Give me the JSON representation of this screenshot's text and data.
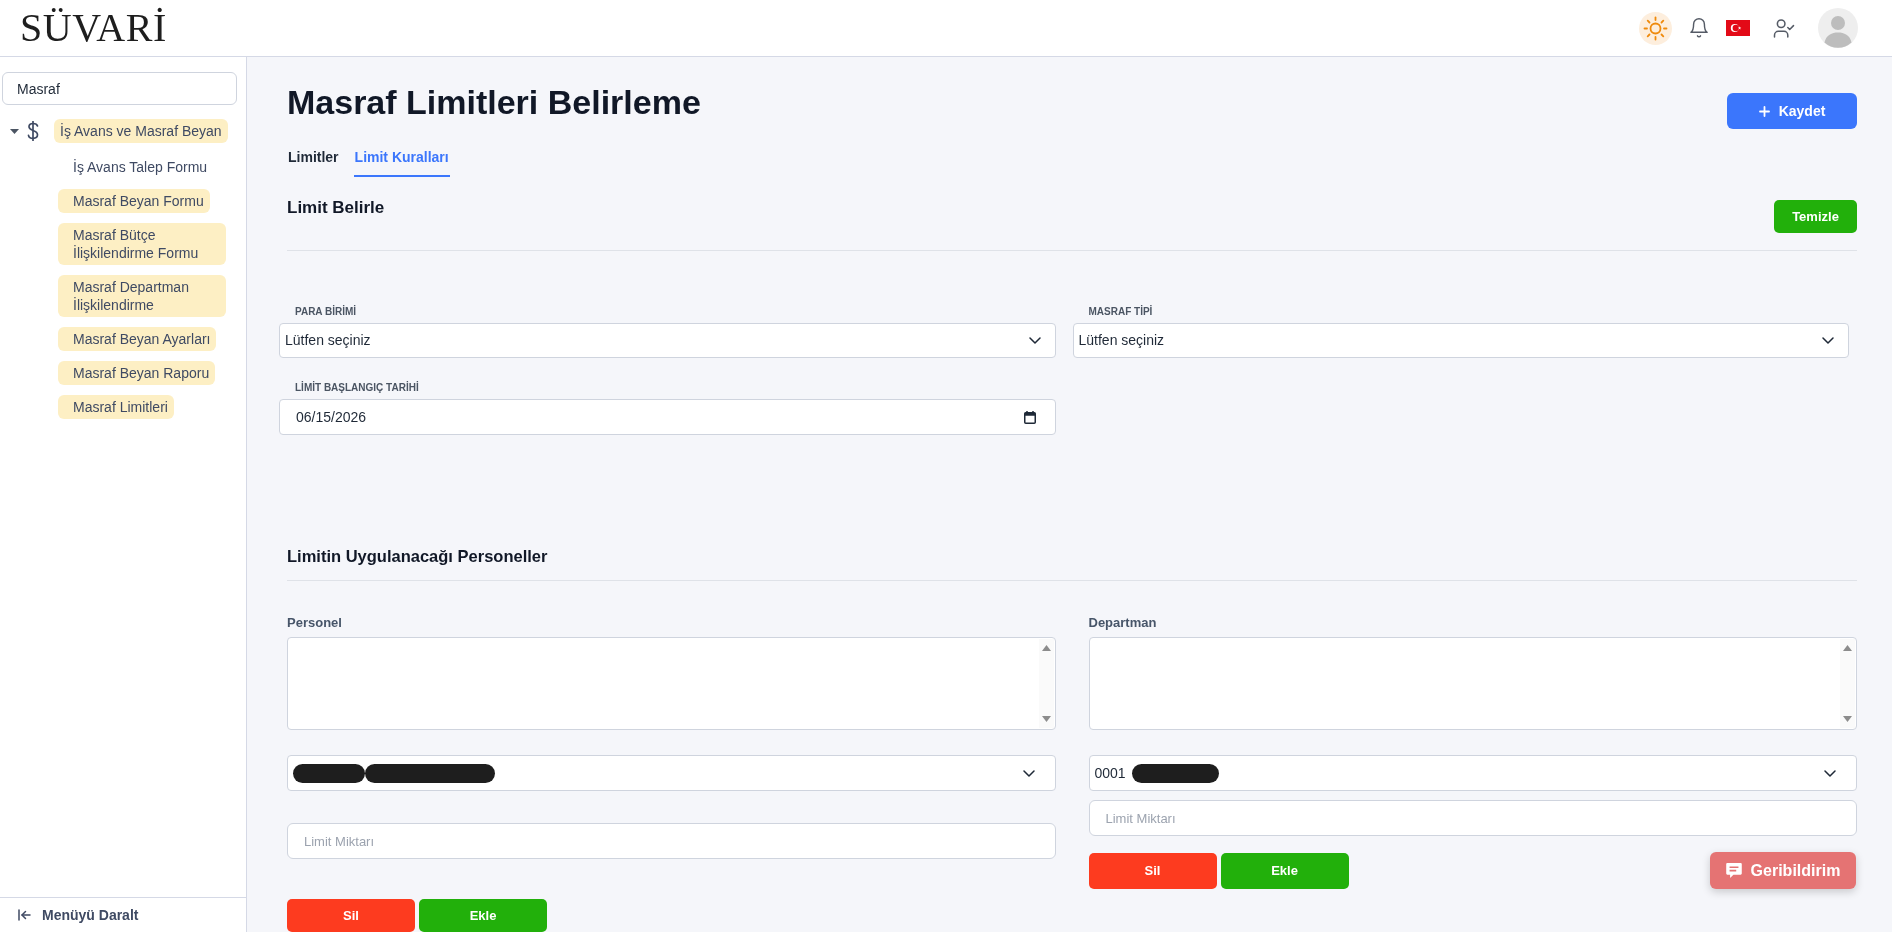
{
  "header": {
    "logo": "SÜVARİ"
  },
  "sidebar": {
    "search": {
      "value": "Masraf"
    },
    "tree": [
      {
        "label": "İş Avans ve Masraf Beyan",
        "expanded": true,
        "highlighted": true,
        "children": [
          {
            "label": "İş Avans Talep Formu",
            "highlighted": false
          },
          {
            "label": "Masraf Beyan Formu",
            "highlighted": true
          },
          {
            "label": "Masraf Bütçe İlişkilendirme Formu",
            "highlighted": true
          },
          {
            "label": "Masraf Departman İlişkilendirme",
            "highlighted": true
          },
          {
            "label": "Masraf Beyan Ayarları",
            "highlighted": true
          },
          {
            "label": "Masraf Beyan Raporu",
            "highlighted": true
          },
          {
            "label": "Masraf Limitleri",
            "highlighted": true
          }
        ]
      }
    ],
    "collapse_button": "Menüyü Daralt"
  },
  "page": {
    "title": "Masraf Limitleri Belirleme",
    "save_button": "Kaydet"
  },
  "tabs": [
    {
      "label": "Limitler",
      "selected": false
    },
    {
      "label": "Limit Kuralları",
      "selected": true
    }
  ],
  "limit_section": {
    "title": "Limit Belirle",
    "clear_button": "Temizle",
    "fields": [
      {
        "kind": "select",
        "label": "PARA BİRİMİ",
        "value": "Lütfen seçiniz"
      },
      {
        "kind": "select",
        "label": "MASRAF TİPİ",
        "value": "Lütfen seçiniz"
      },
      {
        "kind": "date",
        "label": "LİMİT BAŞLANGIÇ TARİHİ",
        "value": "06/15/2026"
      }
    ]
  },
  "personnel_section": {
    "title": "Limitin Uygulanacağı Personeller",
    "columns": [
      {
        "label": "Personel",
        "select": {
          "redactions": [
            {
              "kind": "short"
            },
            {
              "kind": "long"
            }
          ]
        },
        "amount": {
          "placeholder": "Limit Miktarı"
        },
        "buttons": [
          {
            "kind": "delete",
            "label": "Sil"
          },
          {
            "kind": "add",
            "label": "Ekle"
          }
        ]
      },
      {
        "label": "Departman",
        "select": {
          "value": "0001",
          "redactions": [
            {
              "kind": "medium"
            }
          ]
        },
        "amount": {
          "placeholder": "Limit Miktarı"
        },
        "buttons": [
          {
            "kind": "delete",
            "label": "Sil"
          },
          {
            "kind": "add",
            "label": "Ekle"
          }
        ]
      }
    ]
  },
  "feedback_button": "Geribildirim"
}
